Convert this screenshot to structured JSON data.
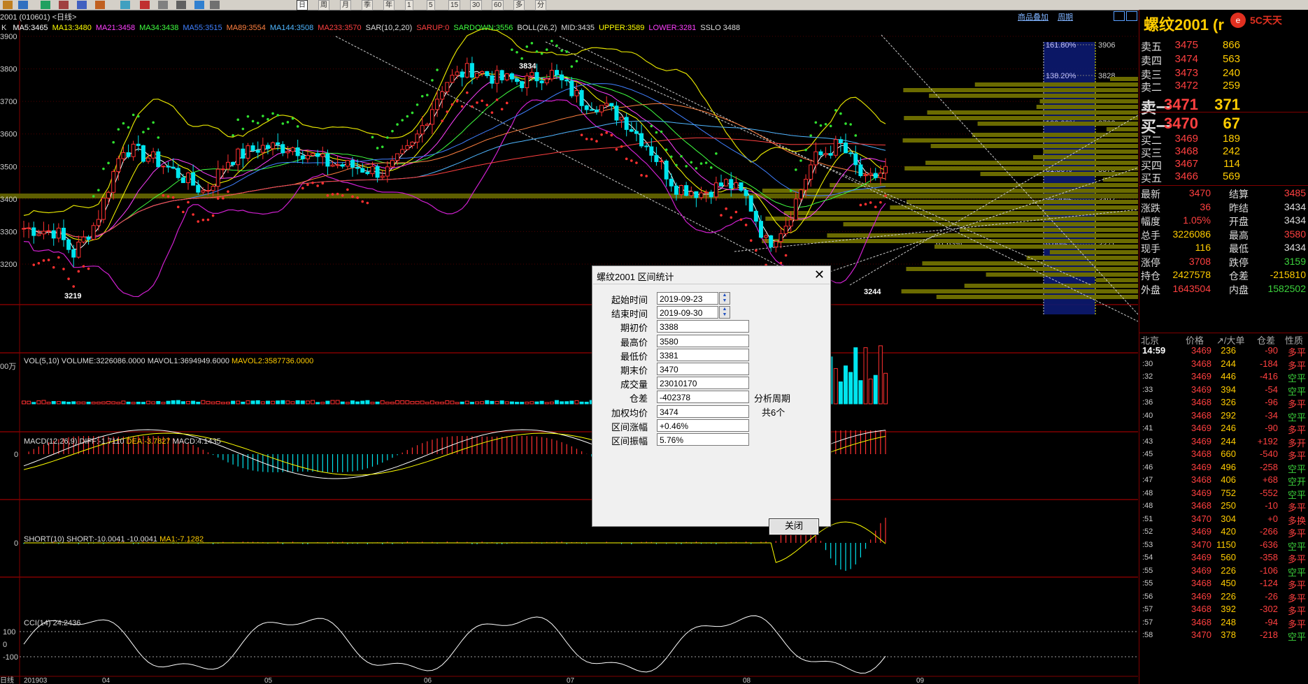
{
  "toolbar": {
    "period_buttons": [
      "日",
      "周",
      "月",
      "季",
      "年",
      "1",
      "5",
      "15",
      "30",
      "60",
      "多",
      "分"
    ]
  },
  "chart": {
    "contract_label": "2001 (010601) <日线>",
    "links": [
      "商品叠加",
      "周期"
    ],
    "ma_line": {
      "k": "K",
      "items": [
        {
          "text": "MA5:3465",
          "color": "#ffffff"
        },
        {
          "text": "MA13:3480",
          "color": "#ffff00"
        },
        {
          "text": "MA21:3458",
          "color": "#ff40ff"
        },
        {
          "text": "MA34:3438",
          "color": "#40ff40"
        },
        {
          "text": "MA55:3515",
          "color": "#4080ff"
        },
        {
          "text": "MA89:3554",
          "color": "#ff8040"
        },
        {
          "text": "MA144:3508",
          "color": "#4fb6ff"
        },
        {
          "text": "MA233:3570",
          "color": "#ff4040"
        },
        {
          "text": "SAR(10,2,20)",
          "color": "#dddddd"
        },
        {
          "text": "SARUP:0",
          "color": "#ff4040"
        },
        {
          "text": "SARDOWN:3556",
          "color": "#40ff40"
        },
        {
          "text": "BOLL(26,2)",
          "color": "#dddddd"
        },
        {
          "text": "MID:3435",
          "color": "#dddddd"
        },
        {
          "text": "UPPER:3589",
          "color": "#ffff00"
        },
        {
          "text": "LOWER:3281",
          "color": "#ff40ff"
        },
        {
          "text": "SSLO 3488",
          "color": "#dddddd"
        }
      ]
    },
    "price_axis": [
      "3900",
      "3800",
      "3700",
      "3600",
      "3500",
      "3400",
      "3300",
      "3200"
    ],
    "annotations": {
      "high": "3834",
      "low1": "3219",
      "low2": "3244"
    },
    "fib_levels": [
      {
        "pct": "161.80%",
        "price": "3906"
      },
      {
        "pct": "138.20%",
        "price": "3828"
      },
      {
        "pct": "100.00%",
        "price": "3702"
      },
      {
        "pct": "61.80%",
        "price": "3575"
      },
      {
        "pct": "38.20%",
        "price": "3497"
      },
      {
        "pct": "0.00%",
        "price": "3371"
      }
    ],
    "fib_extra": [
      "61.63%"
    ],
    "vol_label": "VOL(5,10) VOLUME:3226086.0000",
    "vol_ma1": "MAVOL1:3694949.6000",
    "vol_ma2": "MAVOL2:3587736.0000",
    "vol_axis": "00万",
    "macd_label": "MACD(12,26,9)",
    "macd_diff": "DIFF:-1.7110",
    "macd_dea": "DEA:-3.7827",
    "macd_val": "MACD:4.1435",
    "macd_zero": "0",
    "short_label": "SHORT(10)",
    "short_val": "SHORT:-10.0041",
    "short_val2": "-10.0041",
    "short_ma": "MA1:-7.1282",
    "short_zero": "0",
    "cci_label": "CCI(14)",
    "cci_val": "24.2436",
    "cci_axis": [
      "100",
      "0",
      "-100"
    ],
    "date_axis": [
      "日线",
      "201903",
      "04",
      "05",
      "06",
      "07",
      "08",
      "09"
    ]
  },
  "right_panel": {
    "title": "螺纹2001 (r",
    "logo_text": "5C天天",
    "asks": [
      {
        "label": "卖五",
        "price": "3475",
        "vol": "866"
      },
      {
        "label": "卖四",
        "price": "3474",
        "vol": "563"
      },
      {
        "label": "卖三",
        "price": "3473",
        "vol": "240"
      },
      {
        "label": "卖二",
        "price": "3472",
        "vol": "259"
      },
      {
        "label": "卖一",
        "price": "3471",
        "vol": "371"
      }
    ],
    "bids": [
      {
        "label": "买一",
        "price": "3470",
        "vol": "67"
      },
      {
        "label": "买二",
        "price": "3469",
        "vol": "189"
      },
      {
        "label": "买三",
        "price": "3468",
        "vol": "242"
      },
      {
        "label": "买四",
        "price": "3467",
        "vol": "114"
      },
      {
        "label": "买五",
        "price": "3466",
        "vol": "569"
      }
    ],
    "stats": [
      {
        "l1": "最新",
        "v1": "3470",
        "c1": "red",
        "l2": "结算",
        "v2": "3485",
        "c2": "red"
      },
      {
        "l1": "涨跌",
        "v1": "36",
        "c1": "red",
        "l2": "昨结",
        "v2": "3434",
        "c2": "white"
      },
      {
        "l1": "幅度",
        "v1": "1.05%",
        "c1": "red",
        "l2": "开盘",
        "v2": "3434",
        "c2": "white"
      },
      {
        "l1": "总手",
        "v1": "3226086",
        "c1": "yellow",
        "l2": "最高",
        "v2": "3580",
        "c2": "red"
      },
      {
        "l1": "现手",
        "v1": "116",
        "c1": "yellow",
        "l2": "最低",
        "v2": "3434",
        "c2": "white"
      },
      {
        "l1": "涨停",
        "v1": "3708",
        "c1": "red",
        "l2": "跌停",
        "v2": "3159",
        "c2": "green"
      },
      {
        "l1": "持仓",
        "v1": "2427578",
        "c1": "yellow",
        "l2": "仓差",
        "v2": "-215810",
        "c2": "yellow"
      },
      {
        "l1": "外盘",
        "v1": "1643504",
        "c1": "red",
        "l2": "内盘",
        "v2": "1582502",
        "c2": "green"
      }
    ],
    "tick_header": {
      "c1": "北京",
      "c2": "价格",
      "c3": "↗/大单",
      "c4": "仓差",
      "c5": "性质"
    },
    "ticks": [
      {
        "t": "14:59",
        "p": "3469",
        "v": "236",
        "o": "-90",
        "oc": "red",
        "n": "多平",
        "nc": "red"
      },
      {
        "t": ":30",
        "p": "3468",
        "v": "244",
        "o": "-184",
        "oc": "red",
        "n": "多平",
        "nc": "red"
      },
      {
        "t": ":32",
        "p": "3469",
        "v": "446",
        "o": "-416",
        "oc": "red",
        "n": "空平",
        "nc": "green"
      },
      {
        "t": ":33",
        "p": "3469",
        "v": "394",
        "o": "-54",
        "oc": "red",
        "n": "空平",
        "nc": "green"
      },
      {
        "t": ":36",
        "p": "3468",
        "v": "326",
        "o": "-96",
        "oc": "red",
        "n": "多平",
        "nc": "red"
      },
      {
        "t": ":40",
        "p": "3468",
        "v": "292",
        "o": "-34",
        "oc": "red",
        "n": "空平",
        "nc": "green"
      },
      {
        "t": ":41",
        "p": "3469",
        "v": "246",
        "o": "-90",
        "oc": "red",
        "n": "多平",
        "nc": "red"
      },
      {
        "t": ":43",
        "p": "3469",
        "v": "244",
        "o": "+192",
        "oc": "red",
        "n": "多开",
        "nc": "red"
      },
      {
        "t": ":45",
        "p": "3468",
        "v": "660",
        "o": "-540",
        "oc": "red",
        "n": "多平",
        "nc": "red"
      },
      {
        "t": ":46",
        "p": "3469",
        "v": "496",
        "o": "-258",
        "oc": "red",
        "n": "空平",
        "nc": "green"
      },
      {
        "t": ":47",
        "p": "3468",
        "v": "406",
        "o": "+68",
        "oc": "red",
        "n": "空开",
        "nc": "green"
      },
      {
        "t": ":48",
        "p": "3469",
        "v": "752",
        "o": "-552",
        "oc": "red",
        "n": "空平",
        "nc": "green"
      },
      {
        "t": ":48",
        "p": "3468",
        "v": "250",
        "o": "-10",
        "oc": "red",
        "n": "多平",
        "nc": "red"
      },
      {
        "t": ":51",
        "p": "3470",
        "v": "304",
        "o": "+0",
        "oc": "red",
        "n": "多换",
        "nc": "red"
      },
      {
        "t": ":52",
        "p": "3469",
        "v": "420",
        "o": "-266",
        "oc": "red",
        "n": "多平",
        "nc": "red"
      },
      {
        "t": ":53",
        "p": "3470",
        "v": "1150",
        "o": "-636",
        "oc": "red",
        "n": "空平",
        "nc": "green"
      },
      {
        "t": ":54",
        "p": "3469",
        "v": "560",
        "o": "-358",
        "oc": "red",
        "n": "多平",
        "nc": "red"
      },
      {
        "t": ":55",
        "p": "3469",
        "v": "226",
        "o": "-106",
        "oc": "red",
        "n": "空平",
        "nc": "green"
      },
      {
        "t": ":55",
        "p": "3468",
        "v": "450",
        "o": "-124",
        "oc": "red",
        "n": "多平",
        "nc": "red"
      },
      {
        "t": ":56",
        "p": "3469",
        "v": "226",
        "o": "-26",
        "oc": "red",
        "n": "多平",
        "nc": "red"
      },
      {
        "t": ":57",
        "p": "3468",
        "v": "392",
        "o": "-302",
        "oc": "red",
        "n": "多平",
        "nc": "red"
      },
      {
        "t": ":57",
        "p": "3468",
        "v": "248",
        "o": "-94",
        "oc": "red",
        "n": "多平",
        "nc": "red"
      },
      {
        "t": ":58",
        "p": "3470",
        "v": "378",
        "o": "-218",
        "oc": "red",
        "n": "空平",
        "nc": "green"
      }
    ]
  },
  "dialog": {
    "title": "螺纹2001 区间统计",
    "fields": [
      {
        "label": "起始时间",
        "value": "2019-09-23"
      },
      {
        "label": "结束时间",
        "value": "2019-09-30"
      },
      {
        "label": "期初价",
        "value": "3388"
      },
      {
        "label": "最高价",
        "value": "3580"
      },
      {
        "label": "最低价",
        "value": "3381"
      },
      {
        "label": "期末价",
        "value": "3470"
      },
      {
        "label": "成交量",
        "value": "23010170"
      },
      {
        "label": "仓差",
        "value": "-402378"
      },
      {
        "label": "加权均价",
        "value": "3474"
      },
      {
        "label": "区间涨幅",
        "value": "+0.46%"
      },
      {
        "label": "区间振幅",
        "value": "5.76%"
      }
    ],
    "period_label": "分析周期",
    "period_value": "共6个",
    "close_label": "关闭"
  }
}
